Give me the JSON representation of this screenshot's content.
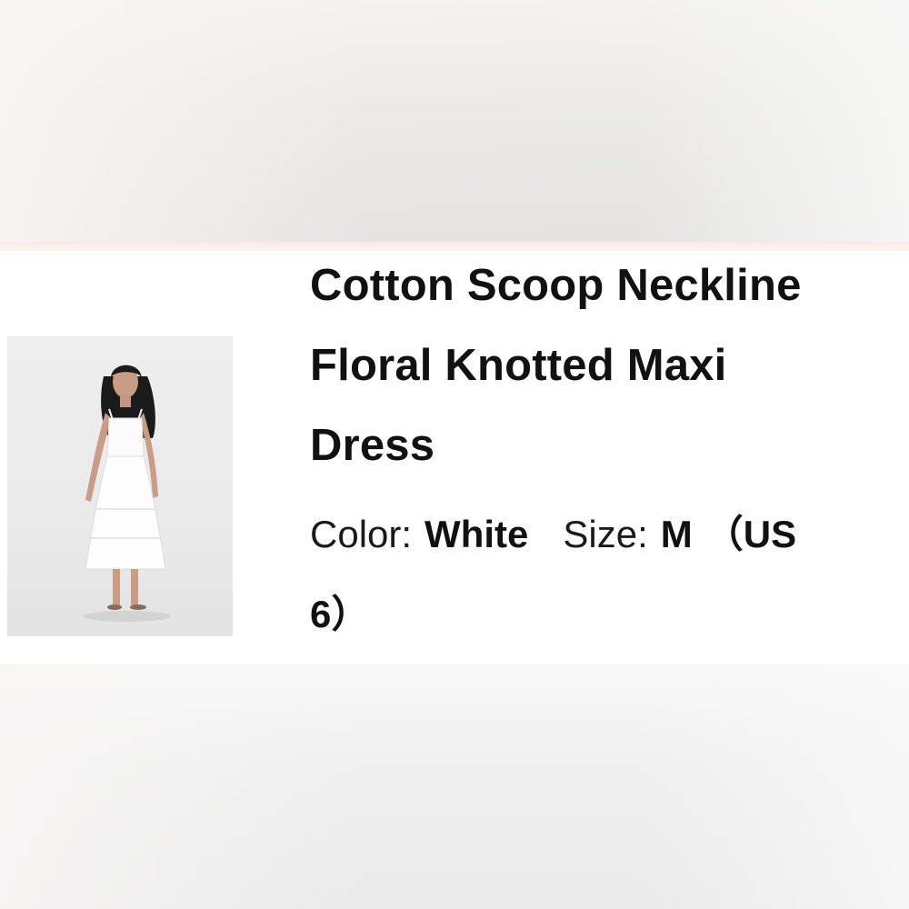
{
  "product": {
    "title_lines": [
      "Cotton Scoop Neckline",
      "Floral Knotted Maxi",
      "Dress"
    ],
    "color_label": "Color:",
    "color_value": "White",
    "size_label": "Size:",
    "size_value": "M",
    "size_detail_open": "（US",
    "size_detail_close": "6）"
  },
  "image": {
    "icon": "product-photo-white-maxi-dress"
  },
  "colors": {
    "card_background": "#ffffff",
    "text": "#111111",
    "accent_line": "#fbe9e2"
  }
}
